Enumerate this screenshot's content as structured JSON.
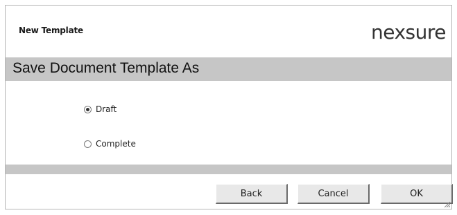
{
  "window": {
    "title": "New Template"
  },
  "brand": {
    "logo_text": "nexsure"
  },
  "header": {
    "title": "Save Document Template As"
  },
  "options": {
    "selected": "Draft",
    "draft_label": "Draft",
    "complete_label": "Complete"
  },
  "buttons": {
    "back": "Back",
    "cancel": "Cancel",
    "ok": "OK"
  },
  "colors": {
    "bar": "#c6c6c6",
    "button_face": "#e8e8e8"
  }
}
